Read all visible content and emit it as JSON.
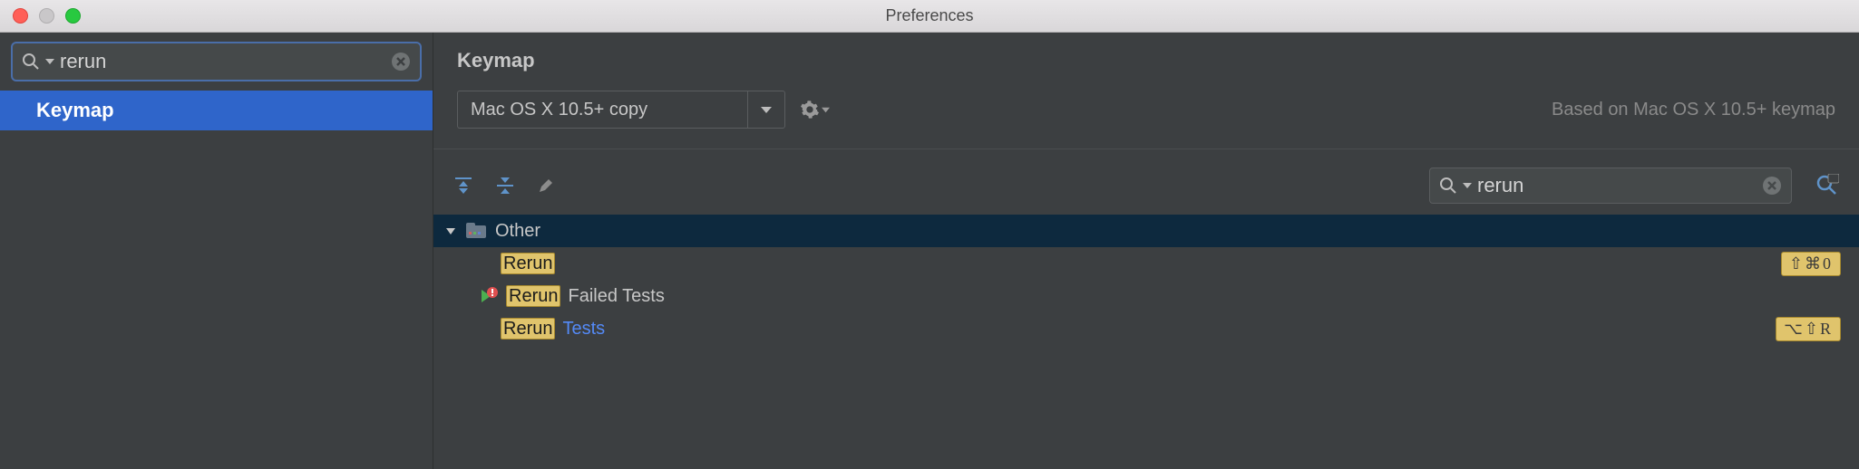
{
  "window": {
    "title": "Preferences"
  },
  "sidebar": {
    "search_value": "rerun",
    "items": [
      {
        "label": "Keymap"
      }
    ]
  },
  "main": {
    "title": "Keymap",
    "scheme": "Mac OS X 10.5+ copy",
    "based_on": "Based on Mac OS X 10.5+ keymap",
    "search_value": "rerun",
    "tree": {
      "group": "Other",
      "rows": [
        {
          "highlight": "Rerun",
          "rest": "",
          "shortcut": "⇧⌘0",
          "icon": null
        },
        {
          "highlight": "Rerun",
          "rest": " Failed Tests",
          "shortcut": "",
          "icon": "rerun-failed-icon"
        },
        {
          "highlight": "Rerun",
          "rest": " Tests",
          "rest_link": true,
          "shortcut": "⌥⇧R",
          "icon": null
        }
      ]
    }
  }
}
